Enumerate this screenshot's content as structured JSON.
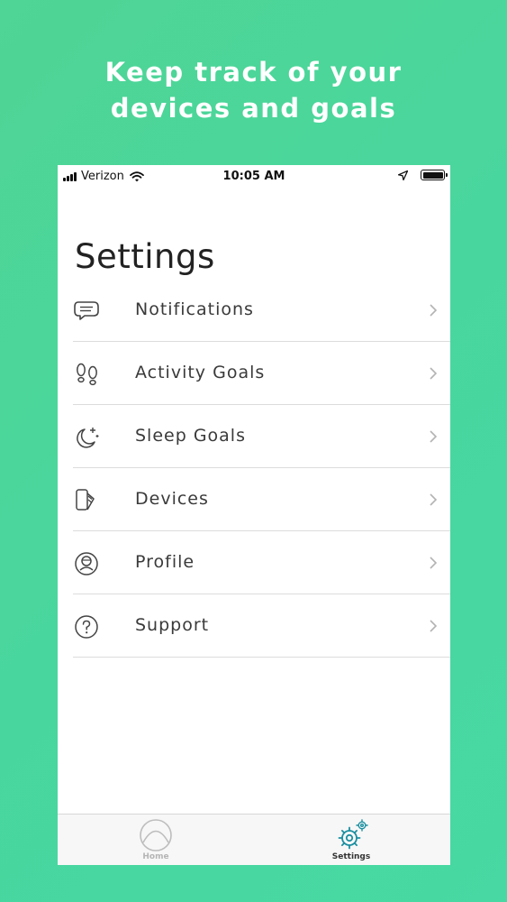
{
  "headline": {
    "line1": "Keep track of your",
    "line2": "devices and goals"
  },
  "status_bar": {
    "carrier": "Verizon",
    "time": "10:05 AM",
    "icons": [
      "signal-icon",
      "wifi-icon",
      "location-arrow-icon",
      "battery-icon"
    ]
  },
  "page": {
    "title": "Settings"
  },
  "settings_items": [
    {
      "label": "Notifications",
      "icon": "chat-bubble-icon"
    },
    {
      "label": "Activity Goals",
      "icon": "footprints-icon"
    },
    {
      "label": "Sleep Goals",
      "icon": "moon-stars-icon"
    },
    {
      "label": "Devices",
      "icon": "device-icon"
    },
    {
      "label": "Profile",
      "icon": "profile-icon"
    },
    {
      "label": "Support",
      "icon": "help-circle-icon"
    }
  ],
  "tab_bar": {
    "tabs": [
      {
        "label": "Home",
        "icon": "home-dome-icon",
        "active": false
      },
      {
        "label": "Settings",
        "icon": "gear-icon",
        "active": true
      }
    ]
  },
  "colors": {
    "background": "#4fd595",
    "accent": "#1a8fa0",
    "text": "#3a3a3a",
    "divider": "#dcdcdc"
  }
}
